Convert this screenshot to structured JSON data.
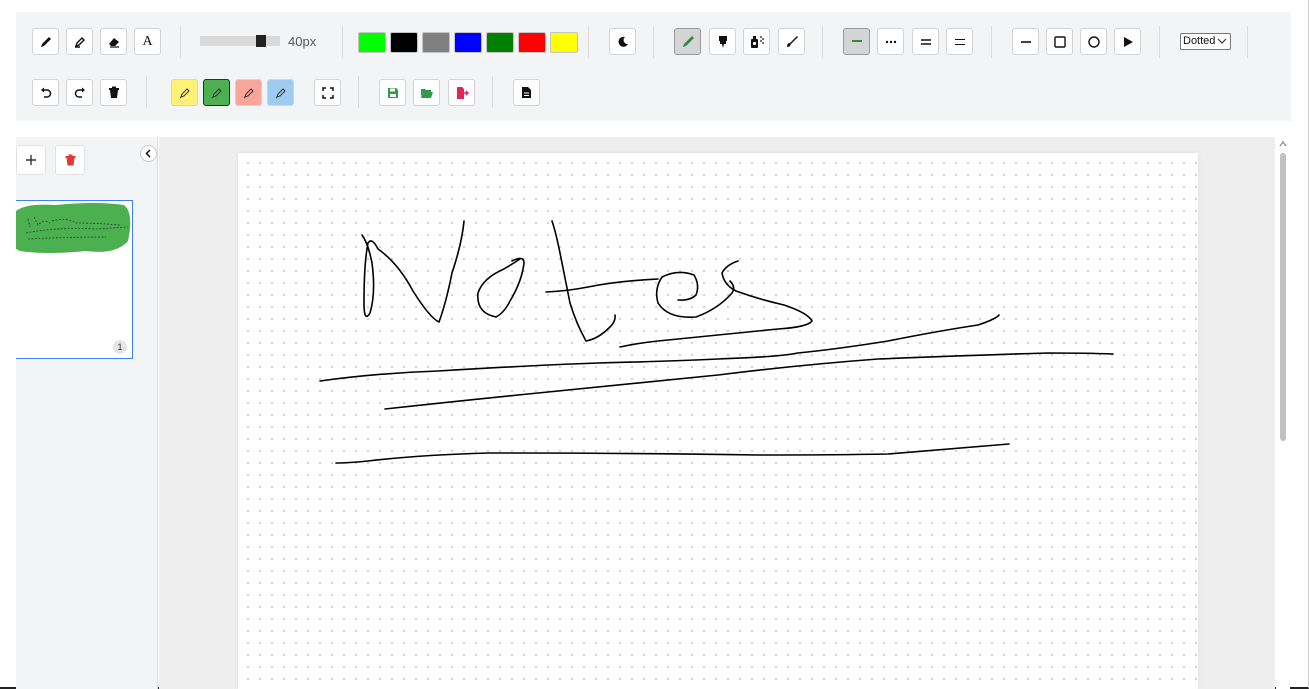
{
  "toolbar": {
    "row1": {
      "tools": [
        {
          "name": "pencil-tool",
          "icon": "pencil-icon"
        },
        {
          "name": "marker-tool",
          "icon": "marker-icon"
        },
        {
          "name": "eraser-tool",
          "icon": "eraser-icon"
        },
        {
          "name": "text-tool",
          "icon": "text-icon",
          "label": "A"
        }
      ],
      "brush_size": {
        "value": 40,
        "max_fraction": 0.8,
        "label": "40px"
      },
      "colors": [
        "#00ff00",
        "#000000",
        "#808080",
        "#0000ff",
        "#008000",
        "#ff0000",
        "#ffff00"
      ],
      "dark_mode_icon": "moon-icon",
      "brush_styles": [
        {
          "name": "brush-pen",
          "icon": "brush-green-icon",
          "active": true
        },
        {
          "name": "brush-marker",
          "icon": "highlighter-icon"
        },
        {
          "name": "brush-spray",
          "icon": "spray-icon"
        },
        {
          "name": "brush-fine",
          "icon": "fine-brush-icon"
        }
      ],
      "line_styles": [
        {
          "name": "solid-line",
          "icon": "solid-line-icon",
          "active": true
        },
        {
          "name": "dotted-line",
          "icon": "dotted-line-icon"
        },
        {
          "name": "double-line",
          "icon": "double-line-icon"
        },
        {
          "name": "thin-double-line",
          "icon": "thin-double-line-icon"
        }
      ],
      "shapes": [
        {
          "name": "line-shape",
          "icon": "line-icon"
        },
        {
          "name": "rectangle-shape",
          "icon": "rectangle-icon"
        },
        {
          "name": "circle-shape",
          "icon": "circle-icon"
        },
        {
          "name": "arrow-shape",
          "icon": "play-icon"
        }
      ],
      "background_select": {
        "value": "Dotted"
      }
    },
    "row2": {
      "actions": [
        "undo-icon",
        "redo-icon",
        "trash-icon"
      ],
      "highlighters": [
        {
          "name": "yellow-highlighter",
          "color": "#fff176"
        },
        {
          "name": "green-highlighter",
          "color": "#4caf50",
          "active": true
        },
        {
          "name": "pink-highlighter",
          "color": "#f8a59a"
        },
        {
          "name": "blue-highlighter",
          "color": "#9ecbf0"
        }
      ],
      "fullscreen_icon": "fullscreen-icon",
      "files": [
        "save-icon",
        "open-folder-icon",
        "export-pdf-icon"
      ],
      "doc_icon": "document-icon"
    }
  },
  "sidebar": {
    "add_page_icon": "plus-icon",
    "delete_page_icon": "trash-icon",
    "collapse_icon": "chevron-left-icon",
    "pages": [
      {
        "number": "1",
        "selected": true
      }
    ]
  },
  "canvas": {
    "background": "dotted",
    "ink_color": "#000000"
  }
}
